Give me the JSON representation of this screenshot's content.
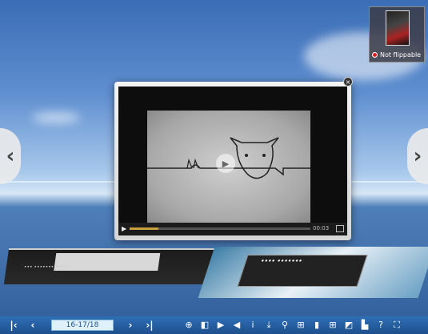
{
  "thumbnail": {
    "status_text": "Not flippable"
  },
  "nav": {
    "prev_arrow": "‹",
    "next_arrow": "›"
  },
  "popup": {
    "close_glyph": "×",
    "video": {
      "play_glyph": "▶",
      "time_text": "00:03",
      "progress": 0.16
    }
  },
  "book": {
    "left_page_text": "••• ••••••• •••••",
    "right_card_title": "•••• •••••••"
  },
  "toolbar": {
    "first_page": "|‹",
    "prev_page": "‹",
    "page_indicator": "16-17/18",
    "next_page": "›",
    "last_page": "›|",
    "icons": [
      {
        "name": "zoom-in-icon",
        "glyph": "⊕"
      },
      {
        "name": "sound-icon",
        "glyph": "◧"
      },
      {
        "name": "autoplay-icon",
        "glyph": "▶"
      },
      {
        "name": "back-icon",
        "glyph": "◀"
      },
      {
        "name": "info-icon",
        "glyph": "i"
      },
      {
        "name": "download-icon",
        "glyph": "⤓"
      },
      {
        "name": "search-icon",
        "glyph": "⚲"
      },
      {
        "name": "tree-icon",
        "glyph": "⊞"
      },
      {
        "name": "bookmark-icon",
        "glyph": "▮"
      },
      {
        "name": "thumbnails-icon",
        "glyph": "⊞"
      },
      {
        "name": "share-icon",
        "glyph": "◩"
      },
      {
        "name": "print-icon",
        "glyph": "▙"
      },
      {
        "name": "help-icon",
        "glyph": "?"
      },
      {
        "name": "fullscreen-icon",
        "glyph": "⛶"
      }
    ]
  },
  "colors": {
    "toolbar": "#1d4f8c",
    "page_input_bg": "#dff1fb",
    "progress": "#c8a040",
    "status_dot": "#e02020"
  }
}
